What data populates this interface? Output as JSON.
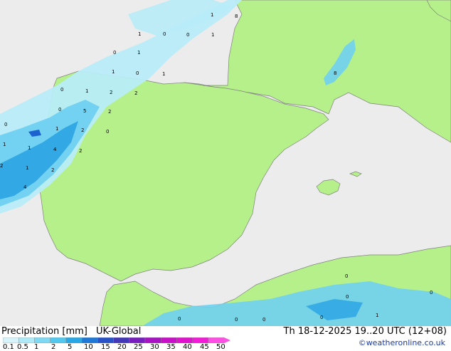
{
  "header": {
    "title": "Precipitation [mm]",
    "model": "UK-Global",
    "valid_time": "Th 18-12-2025 19..20 UTC (12+08)",
    "credit": "©weatheronline.co.uk"
  },
  "legend": {
    "labels": [
      "0.1",
      "0.5",
      "1",
      "2",
      "5",
      "10",
      "15",
      "20",
      "25",
      "30",
      "35",
      "40",
      "45",
      "50"
    ],
    "colors": [
      "#d8f4fb",
      "#aeeaf7",
      "#7fd9f3",
      "#52c8ef",
      "#2aa8e6",
      "#1f78d6",
      "#2a52c8",
      "#4338b8",
      "#7a1fbf",
      "#a612c4",
      "#c810c9",
      "#e012cf",
      "#f21bd8",
      "#ff4fe4"
    ]
  },
  "map": {
    "colors": {
      "sea": "#ececec",
      "land": "#b5f08a",
      "border": "#808080",
      "rain_light": "#b8ecf8",
      "rain_mid": "#6fd0f0",
      "rain_heavy": "#2ea6e4",
      "rain_core": "#1d63d0"
    },
    "values": [
      "1",
      "8",
      "1",
      "0",
      "0",
      "1",
      "0",
      "1",
      "1",
      "0",
      "1",
      "0",
      "1",
      "2",
      "2",
      "0",
      "5",
      "2",
      "8",
      "1",
      "2",
      "0",
      "0",
      "1",
      "4",
      "2",
      "2",
      "1",
      "2",
      "4",
      "1",
      "0",
      "0",
      "0",
      "0",
      "0",
      "0",
      "1",
      "0"
    ]
  }
}
